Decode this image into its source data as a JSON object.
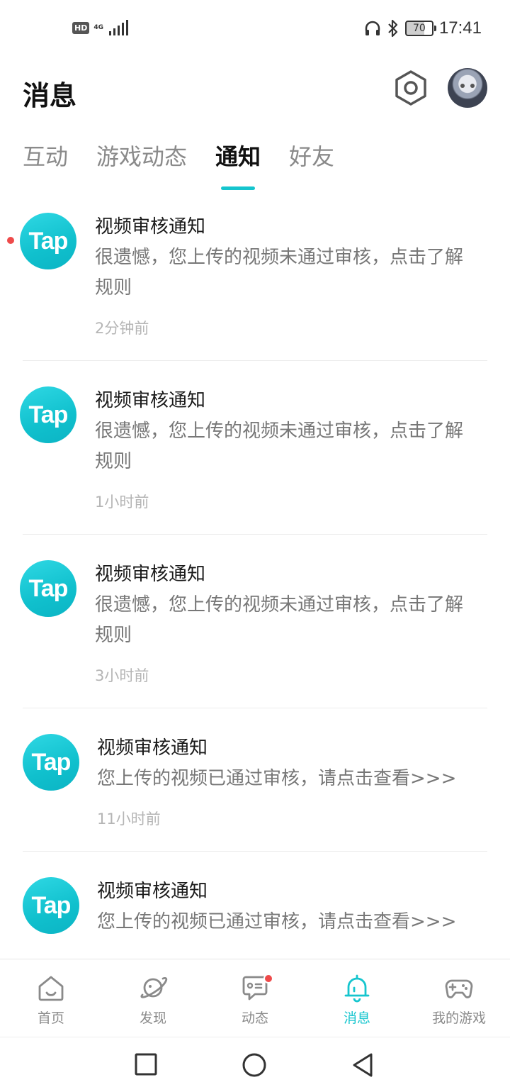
{
  "status_bar": {
    "hd": "HD",
    "network": "4G",
    "battery": "70",
    "time": "17:41"
  },
  "header": {
    "title": "消息",
    "settings_icon": "settings-hexagon-icon",
    "avatar_icon": "user-avatar"
  },
  "tabs": [
    {
      "label": "互动",
      "active": false
    },
    {
      "label": "游戏动态",
      "active": false
    },
    {
      "label": "通知",
      "active": true
    },
    {
      "label": "好友",
      "active": false
    }
  ],
  "notifications": [
    {
      "logo": "Tap",
      "title": "视频审核通知",
      "body": "很遗憾，您上传的视频未通过审核，点击了解规则",
      "time": "2分钟前",
      "unread": true
    },
    {
      "logo": "Tap",
      "title": "视频审核通知",
      "body": "很遗憾，您上传的视频未通过审核，点击了解规则",
      "time": "1小时前",
      "unread": false
    },
    {
      "logo": "Tap",
      "title": "视频审核通知",
      "body": "很遗憾，您上传的视频未通过审核，点击了解规则",
      "time": "3小时前",
      "unread": false
    },
    {
      "logo": "Tap",
      "title": "视频审核通知",
      "body": "您上传的视频已通过审核，请点击查看>>>",
      "time": "11小时前",
      "unread": false
    },
    {
      "logo": "Tap",
      "title": "视频审核通知",
      "body": "您上传的视频已通过审核，请点击查看>>>",
      "time": "",
      "unread": false
    }
  ],
  "bottom_nav": [
    {
      "label": "首页",
      "icon": "home-icon",
      "active": false,
      "badge": false
    },
    {
      "label": "发现",
      "icon": "planet-icon",
      "active": false,
      "badge": false
    },
    {
      "label": "动态",
      "icon": "chat-bubble-icon",
      "active": false,
      "badge": true
    },
    {
      "label": "消息",
      "icon": "bell-icon",
      "active": true,
      "badge": false
    },
    {
      "label": "我的游戏",
      "icon": "gamepad-icon",
      "active": false,
      "badge": false
    }
  ],
  "colors": {
    "accent": "#15c5ce",
    "badge": "#ee4a4a",
    "text_primary": "#1a1a1a",
    "text_secondary": "#777777",
    "text_muted": "#b5b5b5"
  }
}
